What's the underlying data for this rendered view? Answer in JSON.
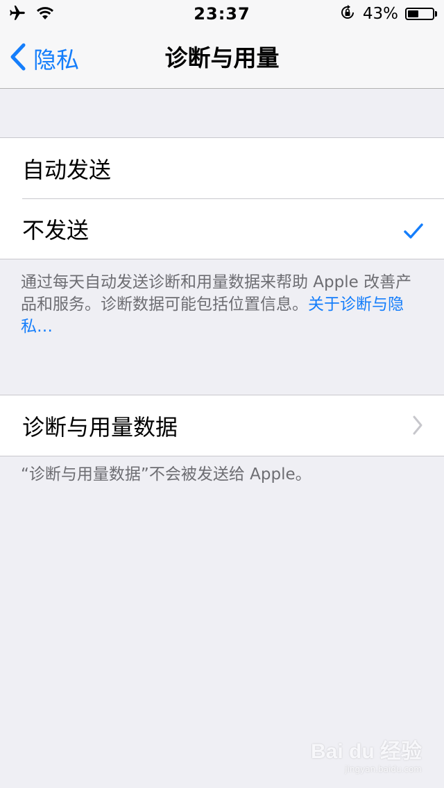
{
  "status_bar": {
    "time": "23:37",
    "battery_percent": "43%",
    "battery_level": 0.43,
    "icons": [
      "airplane-icon",
      "wifi-icon",
      "orientation-lock-icon",
      "battery-icon"
    ]
  },
  "nav": {
    "back_label": "隐私",
    "title": "诊断与用量"
  },
  "send_group": {
    "options": [
      {
        "label": "自动发送",
        "selected": false
      },
      {
        "label": "不发送",
        "selected": true
      }
    ]
  },
  "send_footer": {
    "text": "通过每天自动发送诊断和用量数据来帮助 Apple 改善产品和服务。诊断数据可能包括位置信息。",
    "link": "关于诊断与隐私…"
  },
  "data_group": {
    "item_label": "诊断与用量数据"
  },
  "data_footer": {
    "text": "“诊断与用量数据”不会被发送给 Apple。"
  },
  "watermark": {
    "brand": "Bai du 经验",
    "sub": "jingyan.baidu.com"
  },
  "colors": {
    "accent": "#157efb",
    "background": "#efeff4",
    "footer_text": "#6d6d72",
    "separator": "#c8c7cc"
  }
}
